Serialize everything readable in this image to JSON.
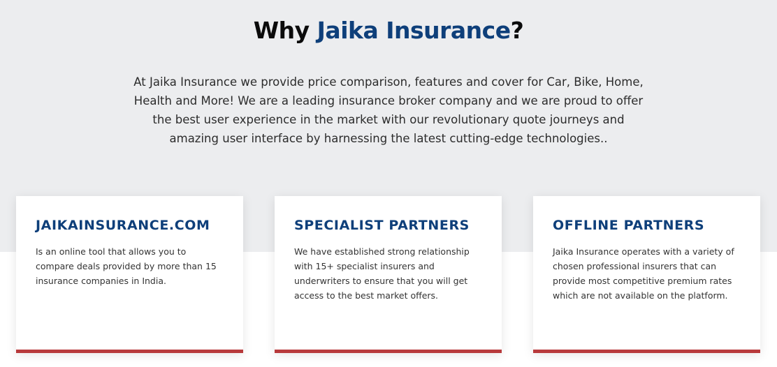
{
  "heading": {
    "prefix": "Why ",
    "brand": "Jaika Insurance",
    "suffix": "?"
  },
  "intro": "At Jaika Insurance we provide price comparison, features and cover for Car, Bike, Home, Health and More! We are a leading insurance broker company and we are proud to offer the best user experience in the market with our revolutionary quote journeys and amazing user interface by harnessing the latest cutting-edge technologies..",
  "colors": {
    "brand_blue": "#0e3f7a",
    "accent_red": "#b83a3c",
    "band_gray": "#ecedef"
  },
  "cards": [
    {
      "title": "JAIKAINSURANCE.COM",
      "text": "Is an online tool that allows you to compare deals provided by more than 15 insurance companies in India."
    },
    {
      "title": "SPECIALIST PARTNERS",
      "text": "We have established strong relationship with 15+ specialist insurers and underwriters to ensure that you will get access to the best market offers."
    },
    {
      "title": "OFFLINE PARTNERS",
      "text": "Jaika Insurance operates with a variety of chosen professional insurers that can provide most competitive premium rates which are not available on the platform."
    }
  ]
}
